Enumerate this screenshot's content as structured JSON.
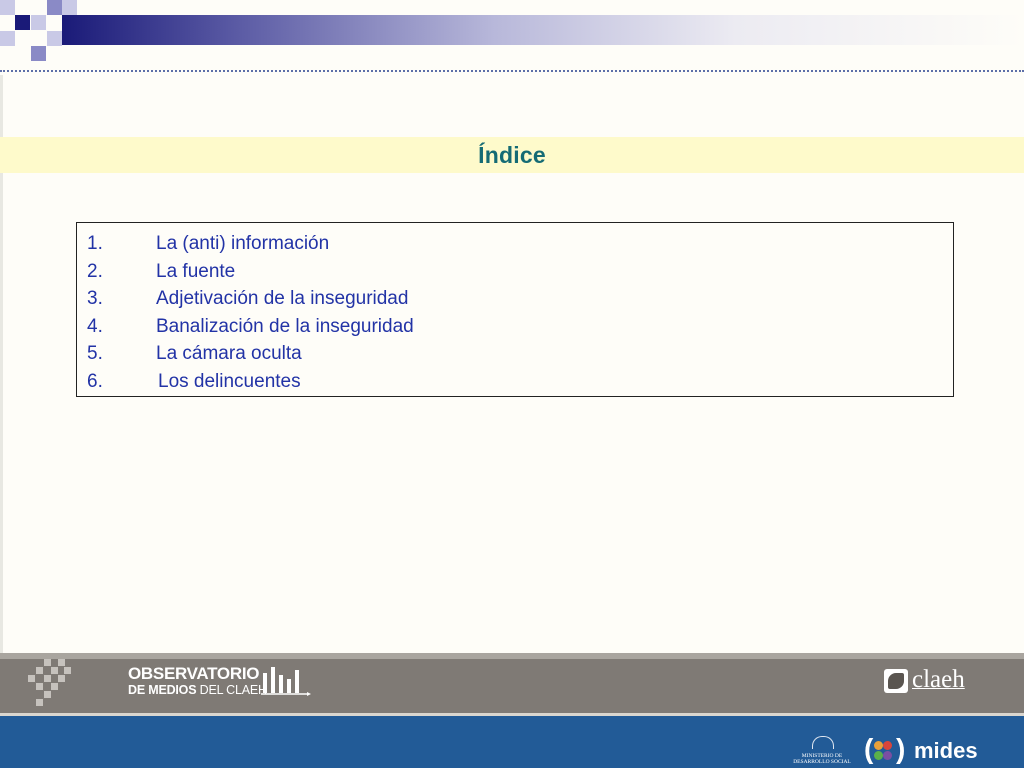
{
  "slide": {
    "title": "Índice",
    "index_items": [
      {
        "number": "1.",
        "label": "La (anti) información"
      },
      {
        "number": "2.",
        "label": "La fuente"
      },
      {
        "number": "3.",
        "label": "Adjetivación de la inseguridad"
      },
      {
        "number": "4.",
        "label": "Banalización de la inseguridad"
      },
      {
        "number": "5.",
        "label": "La cámara oculta"
      },
      {
        "number": "6.",
        "label": "Los delincuentes"
      }
    ]
  },
  "footer": {
    "observatorio_line1": "OBSERVATORIO",
    "observatorio_line2_bold": "DE MEDIOS",
    "observatorio_line2_rest": " DEL CLAEH",
    "claeh_text": "claeh",
    "ministerio_line1": "MINISTERIO DE",
    "ministerio_line2": "DESARROLLO SOCIAL",
    "mides_text": "mides"
  },
  "colors": {
    "title": "#156b74",
    "title_bar": "#fefacb",
    "index_text": "#2233a6",
    "header_dark": "#1a1a78",
    "footer_gray": "#7f7a75",
    "footer_blue": "#225b97"
  },
  "icons": {
    "header": "decorative-squares-icon",
    "observatorio": "bar-chart-icon",
    "claeh": "claeh-mark-icon",
    "ministerio": "sun-seal-icon",
    "mides": "flower-icon"
  }
}
